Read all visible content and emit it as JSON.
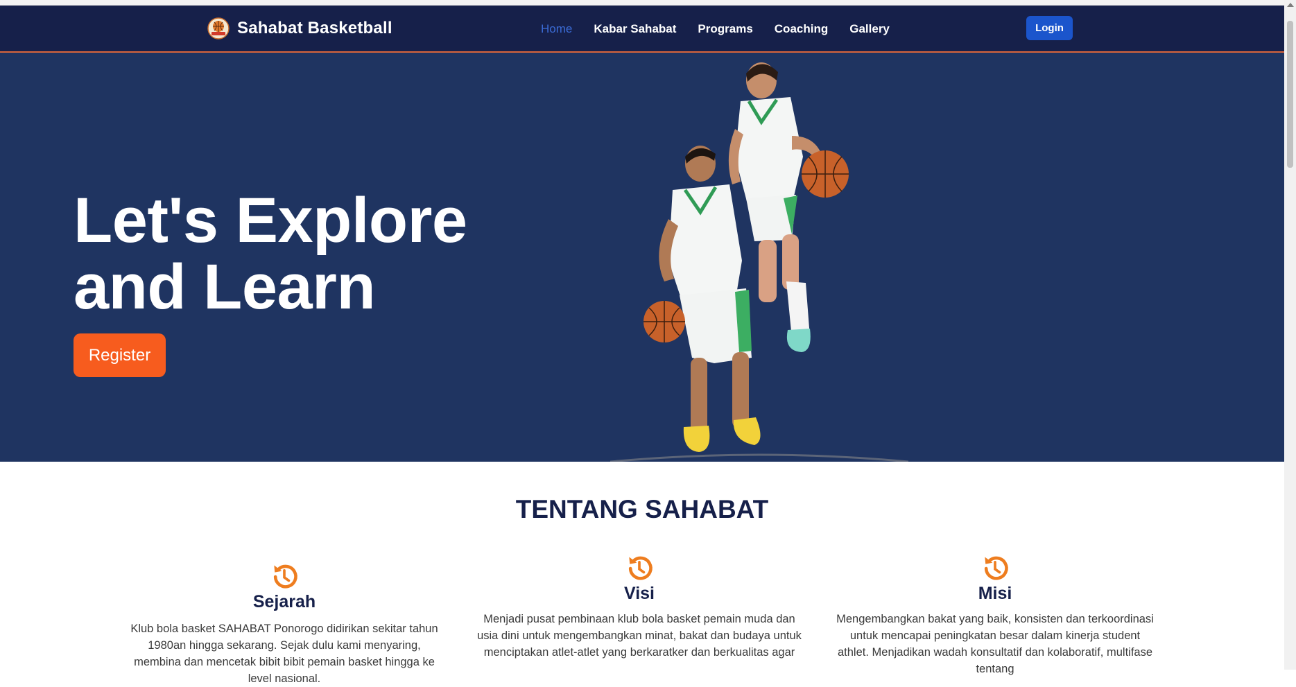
{
  "brand": {
    "name": "Sahabat Basketball",
    "logo_icon": "basketball-club-logo-icon"
  },
  "nav": {
    "links": [
      {
        "label": "Home",
        "active": true
      },
      {
        "label": "Kabar Sahabat",
        "active": false
      },
      {
        "label": "Programs",
        "active": false
      },
      {
        "label": "Coaching",
        "active": false
      },
      {
        "label": "Gallery",
        "active": false
      }
    ],
    "login_label": "Login"
  },
  "hero": {
    "title_line1": "Let's Explore",
    "title_line2": "and Learn",
    "register_label": "Register",
    "image": "two-basketball-players-photo"
  },
  "about": {
    "title": "TENTANG SAHABAT",
    "items": [
      {
        "title": "Sejarah",
        "icon": "history-icon",
        "text": "Klub bola basket SAHABAT Ponorogo didirikan sekitar tahun 1980an hingga sekarang. Sejak dulu kami menyaring, membina dan mencetak bibit bibit pemain basket hingga ke level nasional."
      },
      {
        "title": "Visi",
        "icon": "history-icon",
        "text": "Menjadi pusat pembinaan klub bola basket pemain muda dan usia dini untuk mengembangkan minat, bakat dan budaya untuk menciptakan atlet-atlet yang berkaratker dan berkualitas agar"
      },
      {
        "title": "Misi",
        "icon": "history-icon",
        "text": "Mengembangkan bakat yang baik, konsisten dan terkoordinasi untuk mencapai peningkatan besar dalam kinerja student athlet. Menjadikan wadah konsultatif dan kolaboratif, multifase tentang"
      }
    ]
  },
  "colors": {
    "navbar": "#16204a",
    "hero_bg": "#1f3461",
    "accent_orange": "#f75c1e",
    "login_blue": "#1b55cc",
    "active_link": "#3b6bd6"
  }
}
